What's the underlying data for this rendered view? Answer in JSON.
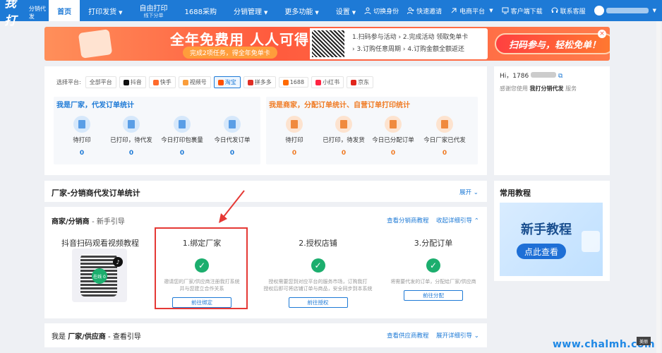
{
  "app": {
    "logo": "我打",
    "logo_sub": "分销代发"
  },
  "nav": [
    {
      "label": "首页",
      "active": true
    },
    {
      "label": "打印发货",
      "caret": true
    },
    {
      "label": "自由打印",
      "sub": "线下分单"
    },
    {
      "label": "1688采购"
    },
    {
      "label": "分销管理",
      "caret": true
    },
    {
      "label": "更多功能",
      "caret": true
    },
    {
      "label": "设置",
      "caret": true
    }
  ],
  "tools": {
    "switch_identity": "切换身份",
    "invite": "快速邀请",
    "ecommerce": "电商平台",
    "client_download": "客户端下载",
    "contact": "联系客服"
  },
  "banner": {
    "gift_text": "全年免费",
    "title": "全年免费用 人人可得",
    "subtitle": "完成2项任务，得全年免单卡",
    "steps_line1": "1.扫码参与活动 › 2.完成活动 领取免单卡",
    "steps_line2": "› 3.订购任意周期 › 4.订购金额全额返还",
    "cta": "扫码参与，轻松免单！",
    "close": "×"
  },
  "platform_filter": {
    "label": "选择平台:",
    "items": [
      {
        "label": "全部平台",
        "color": "#ffffff"
      },
      {
        "label": "抖音",
        "color": "#111111"
      },
      {
        "label": "快手",
        "color": "#ff6a2b"
      },
      {
        "label": "视频号",
        "color": "#fa9d3b"
      },
      {
        "label": "淘宝",
        "color": "#ff5000",
        "active": true
      },
      {
        "label": "拼多多",
        "color": "#e02e24"
      },
      {
        "label": "1688",
        "color": "#ff6a00"
      },
      {
        "label": "小红书",
        "color": "#ff2442"
      },
      {
        "label": "京东",
        "color": "#e1251b"
      }
    ]
  },
  "factory_stats": {
    "title": "我是厂家，代发订单统计",
    "items": [
      {
        "label": "待打印",
        "value": "0"
      },
      {
        "label": "已打印，待代发",
        "value": "0"
      },
      {
        "label": "今日打印包裹量",
        "value": "0"
      },
      {
        "label": "今日代发订单",
        "value": "0"
      }
    ]
  },
  "merchant_stats": {
    "title": "我是商家，分配订单统计、自营订单打印统计",
    "items": [
      {
        "label": "待打印",
        "value": "0"
      },
      {
        "label": "已打印，待发货",
        "value": "0"
      },
      {
        "label": "今日已分配订单",
        "value": "0"
      },
      {
        "label": "今日厂家已代发",
        "value": "0"
      }
    ]
  },
  "account": {
    "hello": "Hi，1786",
    "welcome_prefix": "感谢您使用",
    "welcome_app": "我打分销代发",
    "welcome_suffix": "服务"
  },
  "sections": {
    "stats_title": "厂家-分销商代发订单统计",
    "expand": "展开",
    "dist_title": "商家/分销商",
    "dist_suffix": "- 新手引导",
    "view_dist_tutorial": "查看分销商教程",
    "collapse_guide": "收起详细引导",
    "supplier_prefix": "我是",
    "supplier_title": "厂家/供应商",
    "supplier_suffix": "- 查看引导",
    "view_supplier_tutorial": "查看供应商教程",
    "expand_guide": "展开详细引导",
    "common_tutorial": "常用教程"
  },
  "tutorial_banner": {
    "title": "新手教程",
    "button": "点此查看"
  },
  "guide": {
    "video_title": "抖音扫码观看视频教程",
    "qr_badge": "在线 0",
    "steps": [
      {
        "title": "1.绑定厂家",
        "desc1": "邀请您的厂家/供应商注册我打系统",
        "desc2": "并与您建立合作关系",
        "button": "前往绑定"
      },
      {
        "title": "2.授权店铺",
        "desc1": "授权需要您到对应平台的服务市场，订购我打",
        "desc2": "授权后即可将店铺订单与商品，安全同步到本系统",
        "button": "前往授权"
      },
      {
        "title": "3.分配订单",
        "desc1": "将需要代发的订单，分配给厂家/供应商",
        "desc2": "",
        "button": "前往分配"
      }
    ]
  },
  "watermark": "www.chalmh.com",
  "corner_mark": "美丽",
  "colors": {
    "primary": "#1e7ad6",
    "success": "#1cae6e",
    "highlight": "#e53935"
  }
}
